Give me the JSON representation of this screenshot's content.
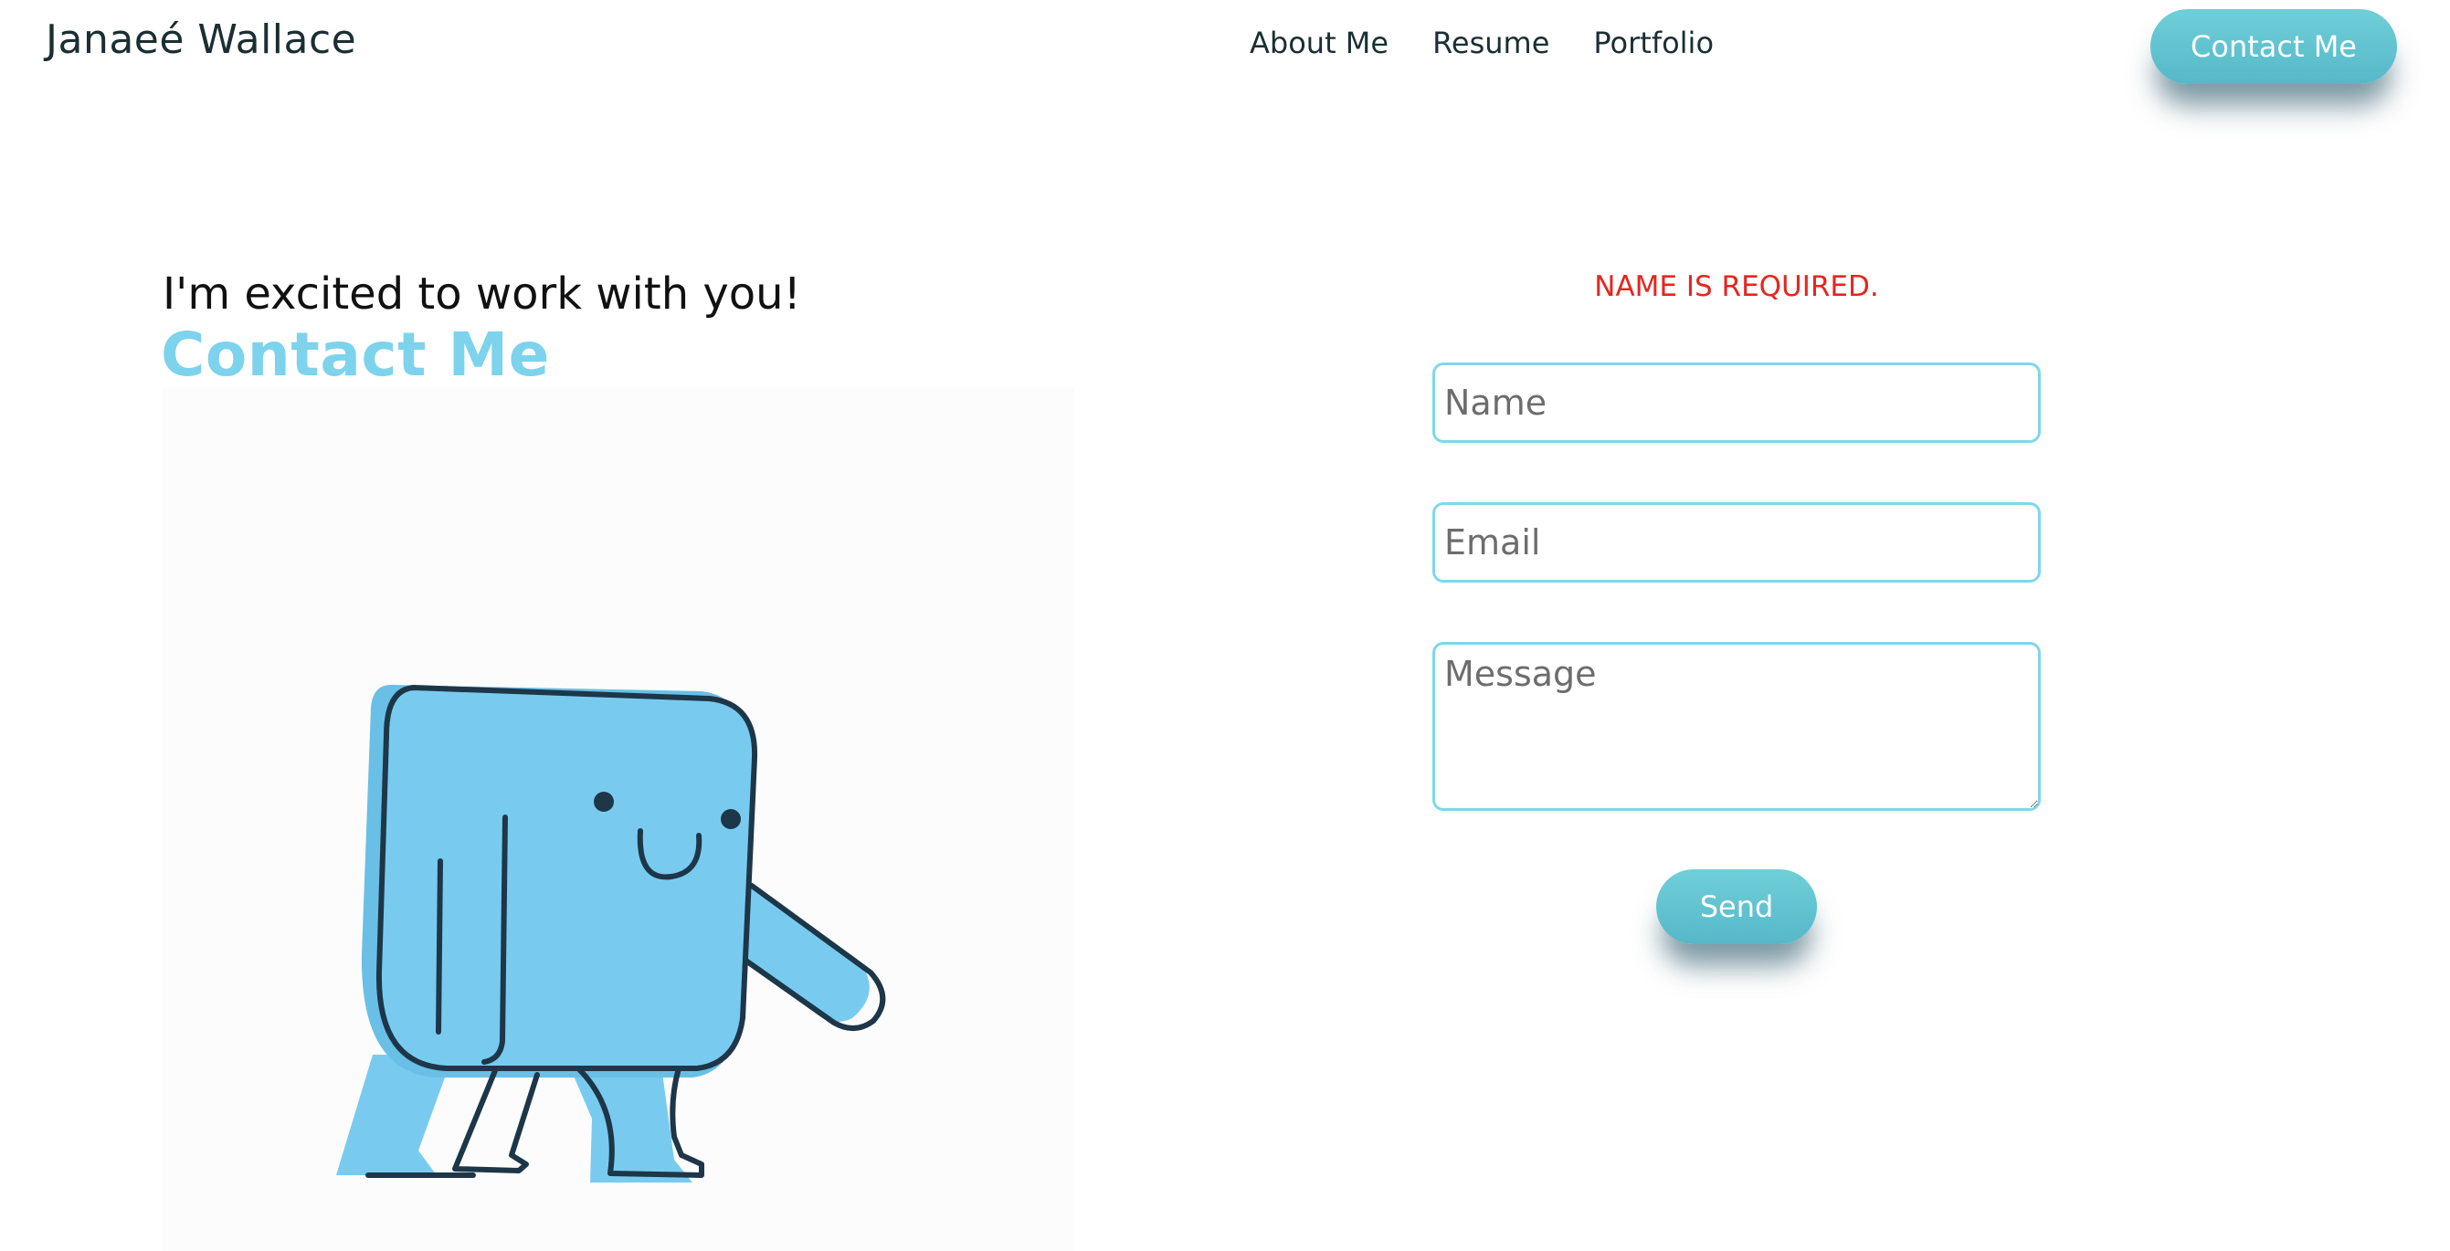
{
  "header": {
    "brand": "Janaeé Wallace",
    "nav": [
      {
        "label": "About Me"
      },
      {
        "label": "Resume"
      },
      {
        "label": "Portfolio"
      }
    ],
    "cta_label": "Contact Me"
  },
  "hero": {
    "intro": "I'm excited to work with you!",
    "heading": "Contact Me",
    "illustration_icon": "walking-blue-block-character"
  },
  "form": {
    "error": "NAME IS REQUIRED.",
    "name_placeholder": "Name",
    "email_placeholder": "Email",
    "message_placeholder": "Message",
    "send_label": "Send"
  },
  "colors": {
    "accent": "#7dd3ec",
    "button": "#5fc2cf",
    "error": "#e5261f",
    "nav_text": "#1b2f33",
    "character": "#78cbef"
  }
}
